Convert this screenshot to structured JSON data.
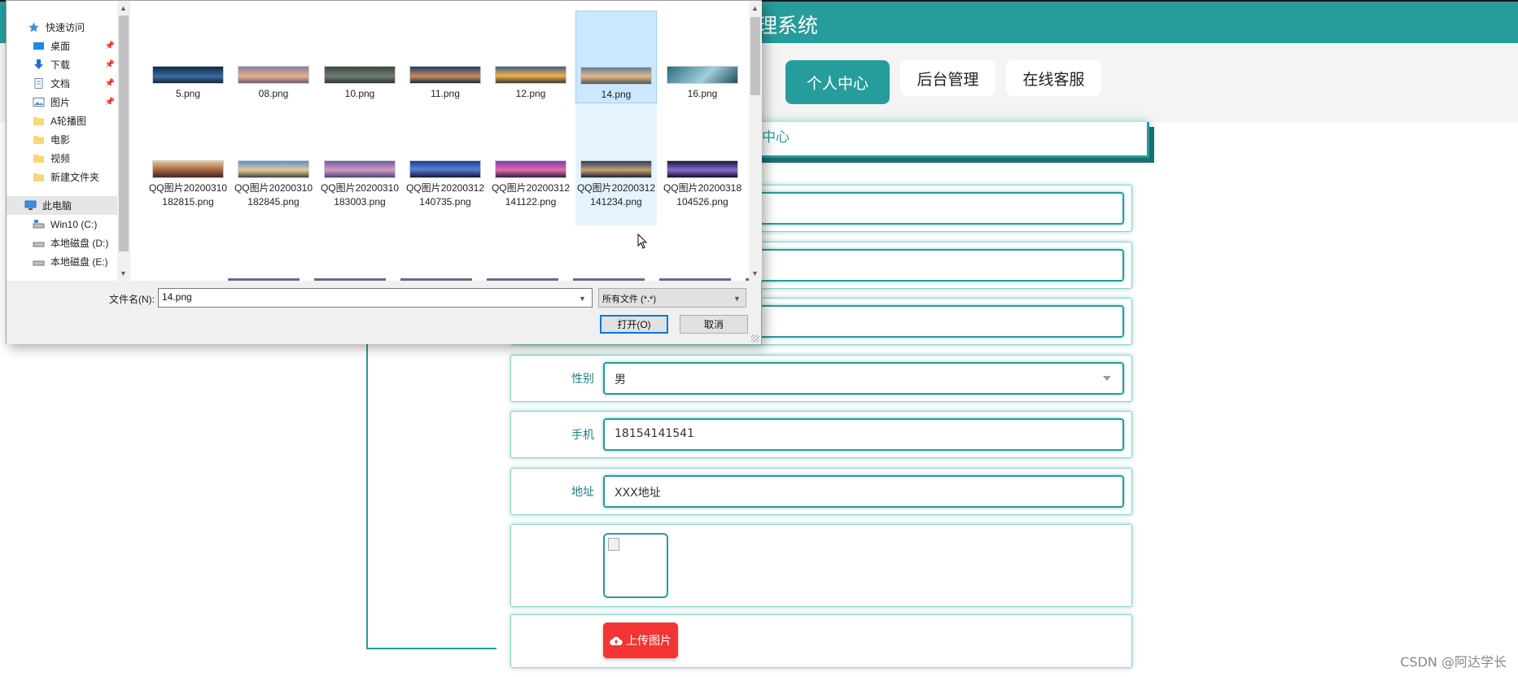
{
  "site": {
    "title_fragment": "理系统",
    "breadcrumb_fragment": "中心",
    "nav": [
      {
        "label": "个人中心",
        "active": true
      },
      {
        "label": "后台管理",
        "active": false
      },
      {
        "label": "在线客服",
        "active": false
      }
    ]
  },
  "form": {
    "gender": {
      "label": "性别",
      "value": "男"
    },
    "phone": {
      "label": "手机",
      "value": "18154141541"
    },
    "address": {
      "label": "地址",
      "value": "XXX地址"
    },
    "upload_label": "上传图片"
  },
  "watermark": "CSDN @阿达学长",
  "dialog": {
    "nav_items": [
      {
        "label": "快速访问",
        "icon": "star-icon"
      },
      {
        "label": "桌面",
        "icon": "desktop-icon",
        "pinned": true
      },
      {
        "label": "下载",
        "icon": "download-icon",
        "pinned": true
      },
      {
        "label": "文档",
        "icon": "document-icon",
        "pinned": true
      },
      {
        "label": "图片",
        "icon": "picture-icon",
        "pinned": true
      },
      {
        "label": "A轮播图",
        "icon": "folder-icon"
      },
      {
        "label": "电影",
        "icon": "folder-icon"
      },
      {
        "label": "视频",
        "icon": "folder-icon"
      },
      {
        "label": "新建文件夹",
        "icon": "folder-icon"
      },
      {
        "label": "此电脑",
        "icon": "computer-icon"
      },
      {
        "label": "Win10 (C:)",
        "icon": "drive-icon"
      },
      {
        "label": "本地磁盘 (D:)",
        "icon": "drive-icon"
      },
      {
        "label": "本地磁盘 (E:)",
        "icon": "drive-icon"
      }
    ],
    "files_row1": [
      "5.png",
      "08.png",
      "10.png",
      "11.png",
      "12.png",
      "14.png",
      "16.png"
    ],
    "files_row2": [
      "QQ图片20200310182815.png",
      "QQ图片20200310182845.png",
      "QQ图片20200310183003.png",
      "QQ图片20200312140735.png",
      "QQ图片20200312141122.png",
      "QQ图片20200312141234.png",
      "QQ图片20200318104526.png"
    ],
    "filename_label": "文件名(N):",
    "filename_value": "14.png",
    "filetype_value": "所有文件 (*.*)",
    "open_label": "打开(O)",
    "cancel_label": "取消"
  },
  "colors": {
    "accent": "#279c9c",
    "upload": "#f23434",
    "selection": "#cce8ff"
  }
}
